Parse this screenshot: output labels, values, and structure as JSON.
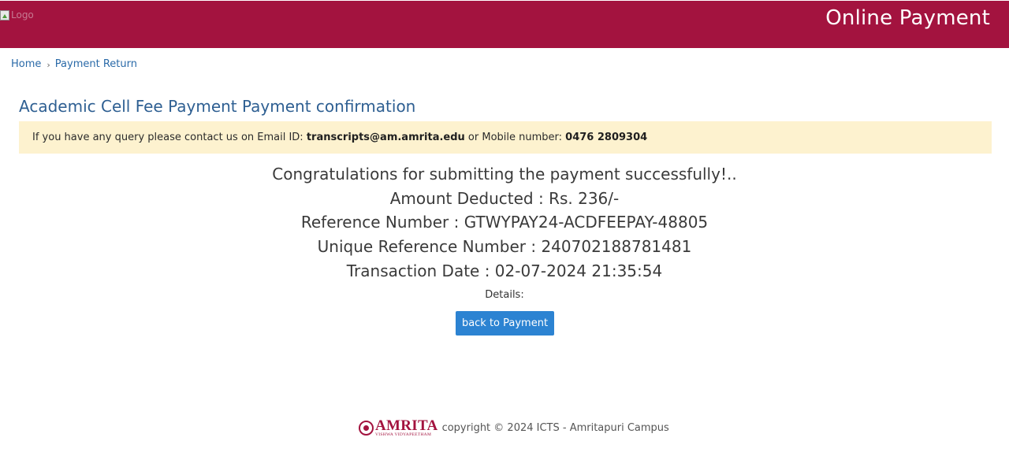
{
  "header": {
    "logo_alt": "Logo",
    "title": "Online Payment"
  },
  "breadcrumb": {
    "home": "Home",
    "separator": "›",
    "current": "Payment Return"
  },
  "page": {
    "title": "Academic Cell Fee Payment Payment confirmation"
  },
  "alert": {
    "text_before": "If you have any query please contact us on Email ID: ",
    "email": "transcripts@am.amrita.edu",
    "text_middle": " or Mobile number: ",
    "phone": "0476 2809304"
  },
  "confirmation": {
    "message": "Congratulations for submitting the payment successfully!..",
    "amount": "Amount Deducted : Rs. 236/-",
    "reference": "Reference Number : GTWYPAY24-ACDFEEPAY-48805",
    "unique_reference": "Unique Reference Number : 240702188781481",
    "transaction_date": "Transaction Date : 02-07-2024 21:35:54",
    "details_label": "Details:"
  },
  "actions": {
    "back_label": "back to Payment"
  },
  "footer": {
    "brand_name": "AMRITA",
    "brand_tagline": "VISHWA VIDYAPEETHAM",
    "copyright": "copyright © 2024 ICTS - Amritapuri Campus"
  },
  "colors": {
    "header_bg": "#a3133f",
    "link": "#2a6aa8",
    "alert_bg": "#fdf2cf",
    "button_bg": "#2c83d2"
  }
}
